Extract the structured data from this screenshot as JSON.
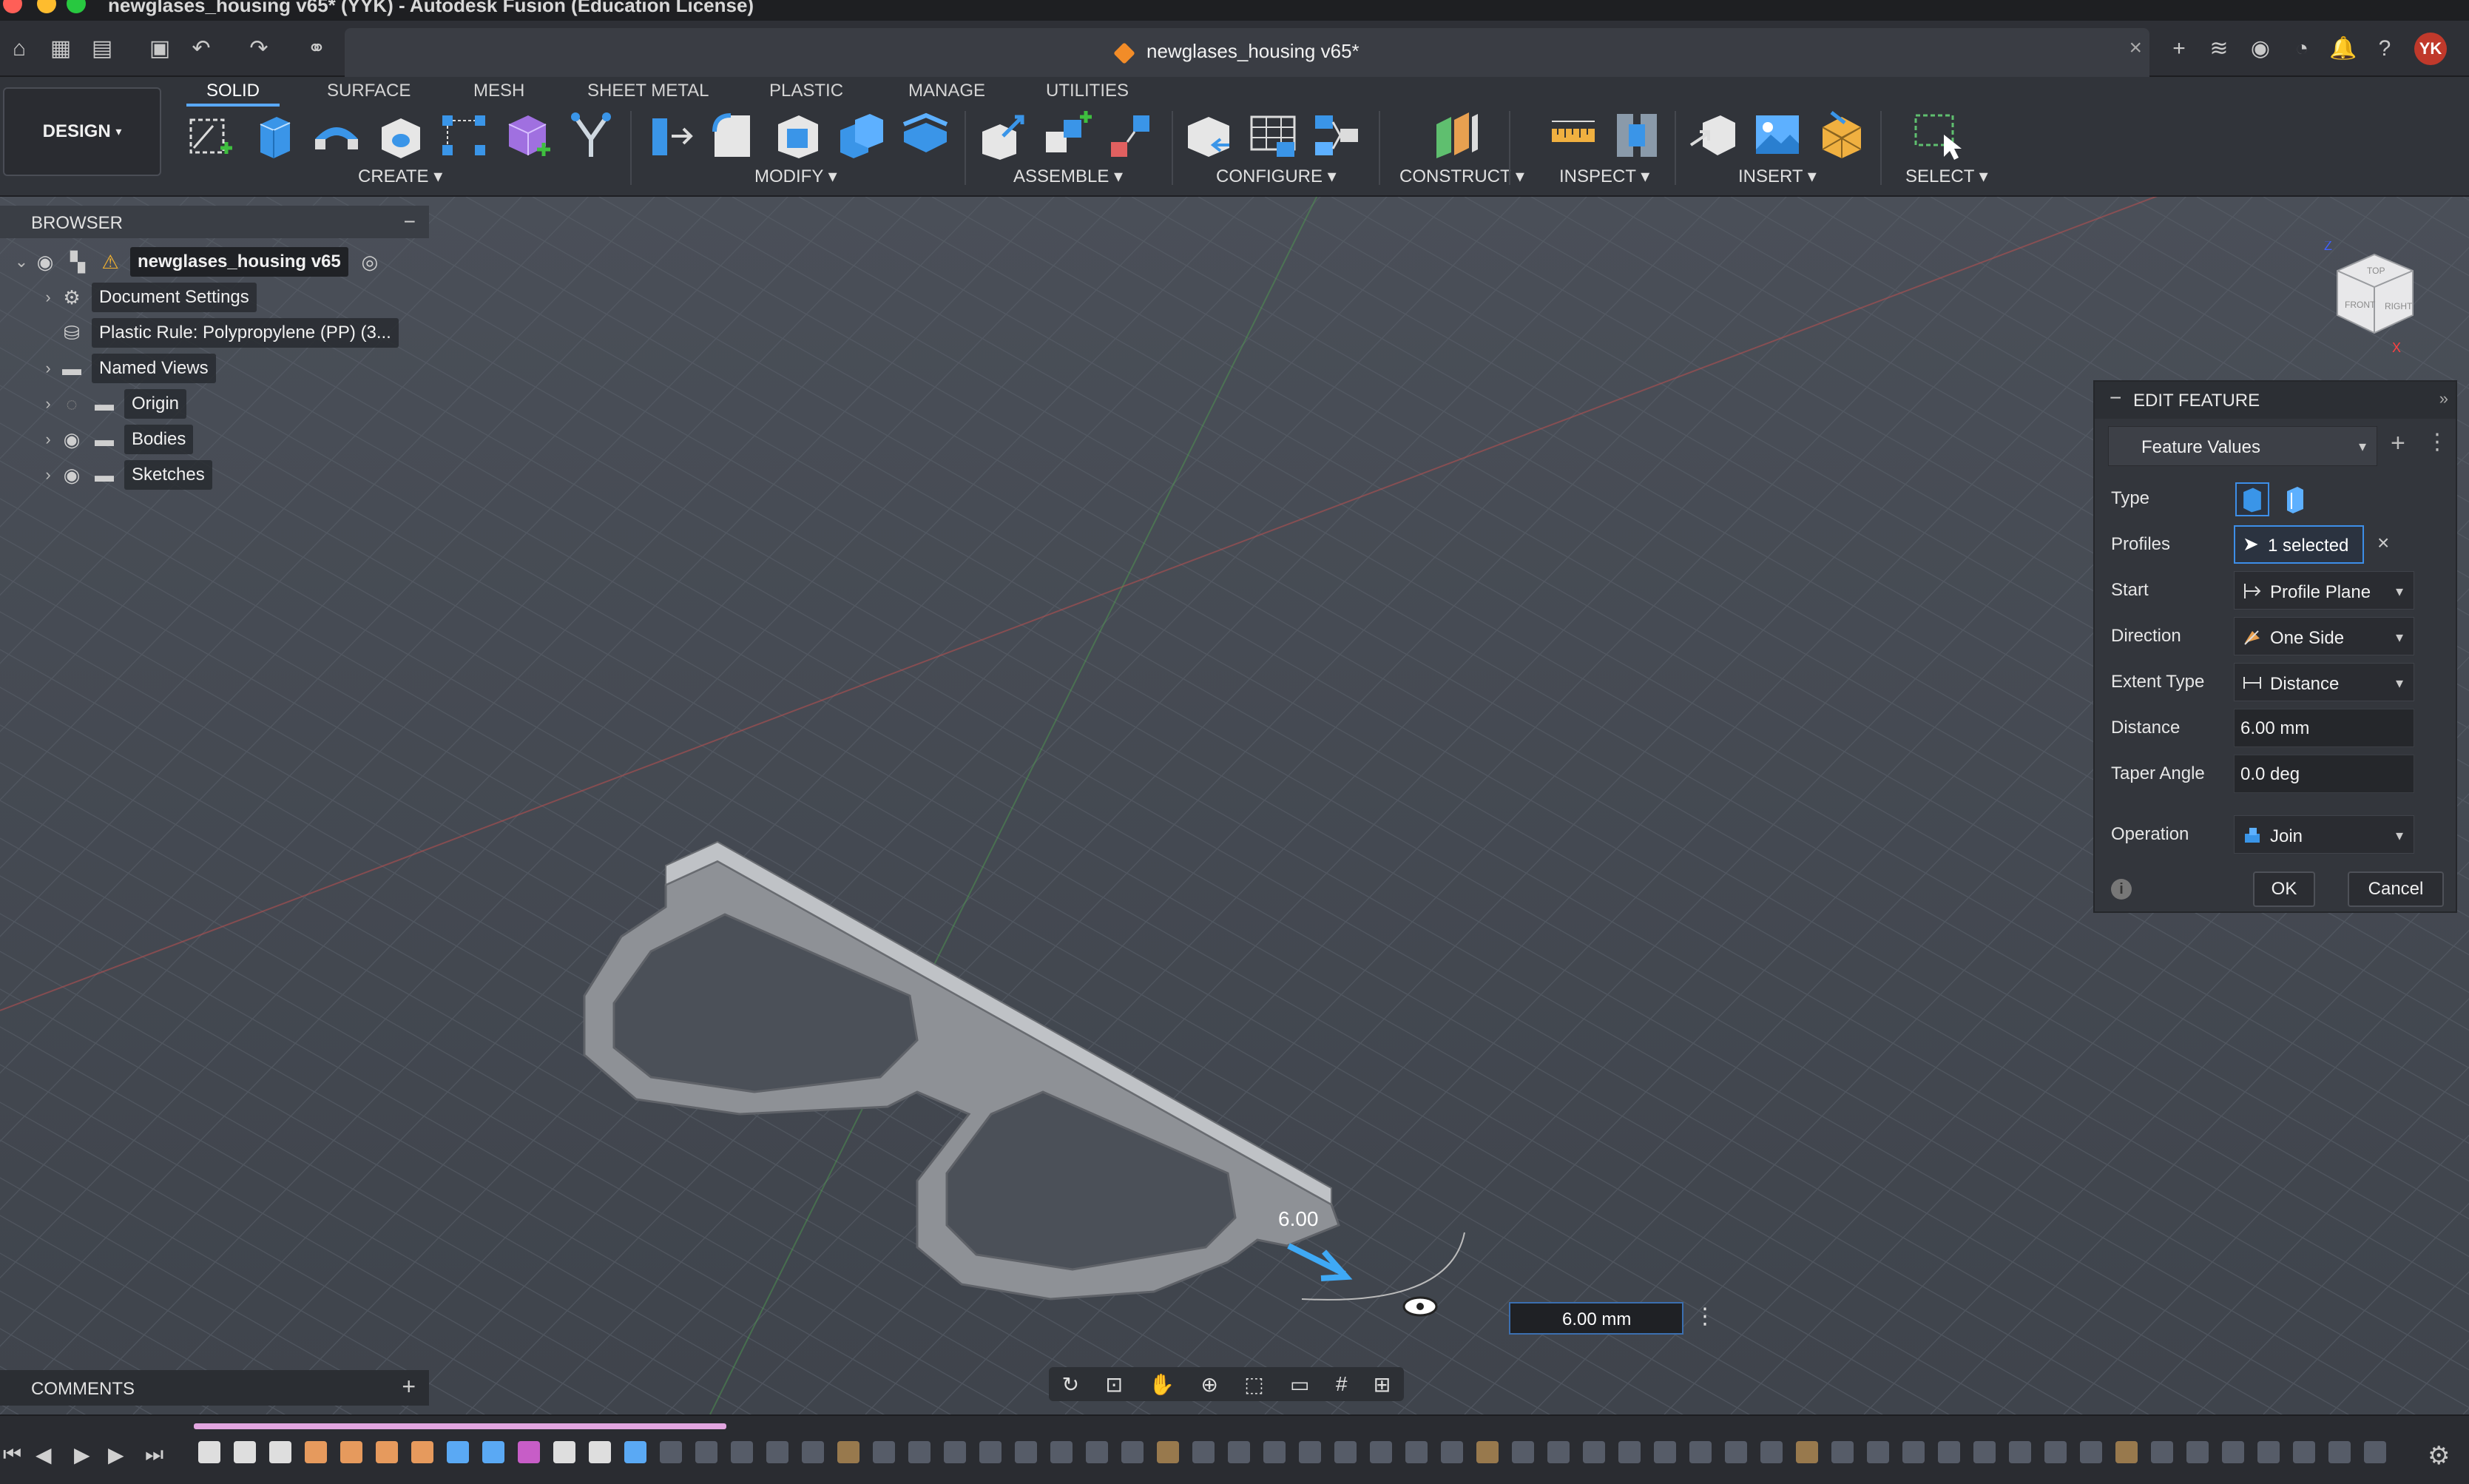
{
  "window": {
    "title": "newglases_housing v65* (YYK) - Autodesk Fusion (Education License)"
  },
  "appbar": {
    "doc_tab_title": "newglases_housing v65*",
    "user_initials": "YK"
  },
  "toolbar": {
    "workspace": "DESIGN",
    "tabs": [
      "SOLID",
      "SURFACE",
      "MESH",
      "SHEET METAL",
      "PLASTIC",
      "MANAGE",
      "UTILITIES"
    ],
    "active_tab": "SOLID",
    "groups": [
      "CREATE",
      "MODIFY",
      "ASSEMBLE",
      "CONFIGURE",
      "CONSTRUCT",
      "INSPECT",
      "INSERT",
      "SELECT"
    ]
  },
  "browser": {
    "title": "BROWSER",
    "root": "newglases_housing v65",
    "items": [
      {
        "label": "Document Settings",
        "icon": "gear-icon"
      },
      {
        "label": "Plastic Rule: Polypropylene (PP) (3...",
        "icon": "plastic-rule-icon"
      },
      {
        "label": "Named Views",
        "icon": "folder-icon"
      },
      {
        "label": "Origin",
        "icon": "folder-icon"
      },
      {
        "label": "Bodies",
        "icon": "folder-icon"
      },
      {
        "label": "Sketches",
        "icon": "folder-icon"
      }
    ]
  },
  "edit_feature": {
    "title": "EDIT FEATURE",
    "dropdown": "Feature Values",
    "rows": {
      "type_label": "Type",
      "profiles_label": "Profiles",
      "profiles_value": "1 selected",
      "start_label": "Start",
      "start_value": "Profile Plane",
      "direction_label": "Direction",
      "direction_value": "One Side",
      "extent_label": "Extent Type",
      "extent_value": "Distance",
      "distance_label": "Distance",
      "distance_value": "6.00 mm",
      "taper_label": "Taper Angle",
      "taper_value": "0.0 deg",
      "operation_label": "Operation",
      "operation_value": "Join"
    },
    "ok_label": "OK",
    "cancel_label": "Cancel"
  },
  "viewport": {
    "dimension_on_model": "6.00",
    "dimension_input": "6.00 mm",
    "viewcube_faces": [
      "TOP",
      "FRONT",
      "RIGHT"
    ],
    "axis_labels": [
      "Z",
      "X"
    ]
  },
  "comments": {
    "title": "COMMENTS"
  },
  "colors": {
    "accent": "#5aa9ff",
    "selection": "#3d8ee8",
    "user_avatar": "#c0392b",
    "timeline_active": "#e2a6e0"
  }
}
